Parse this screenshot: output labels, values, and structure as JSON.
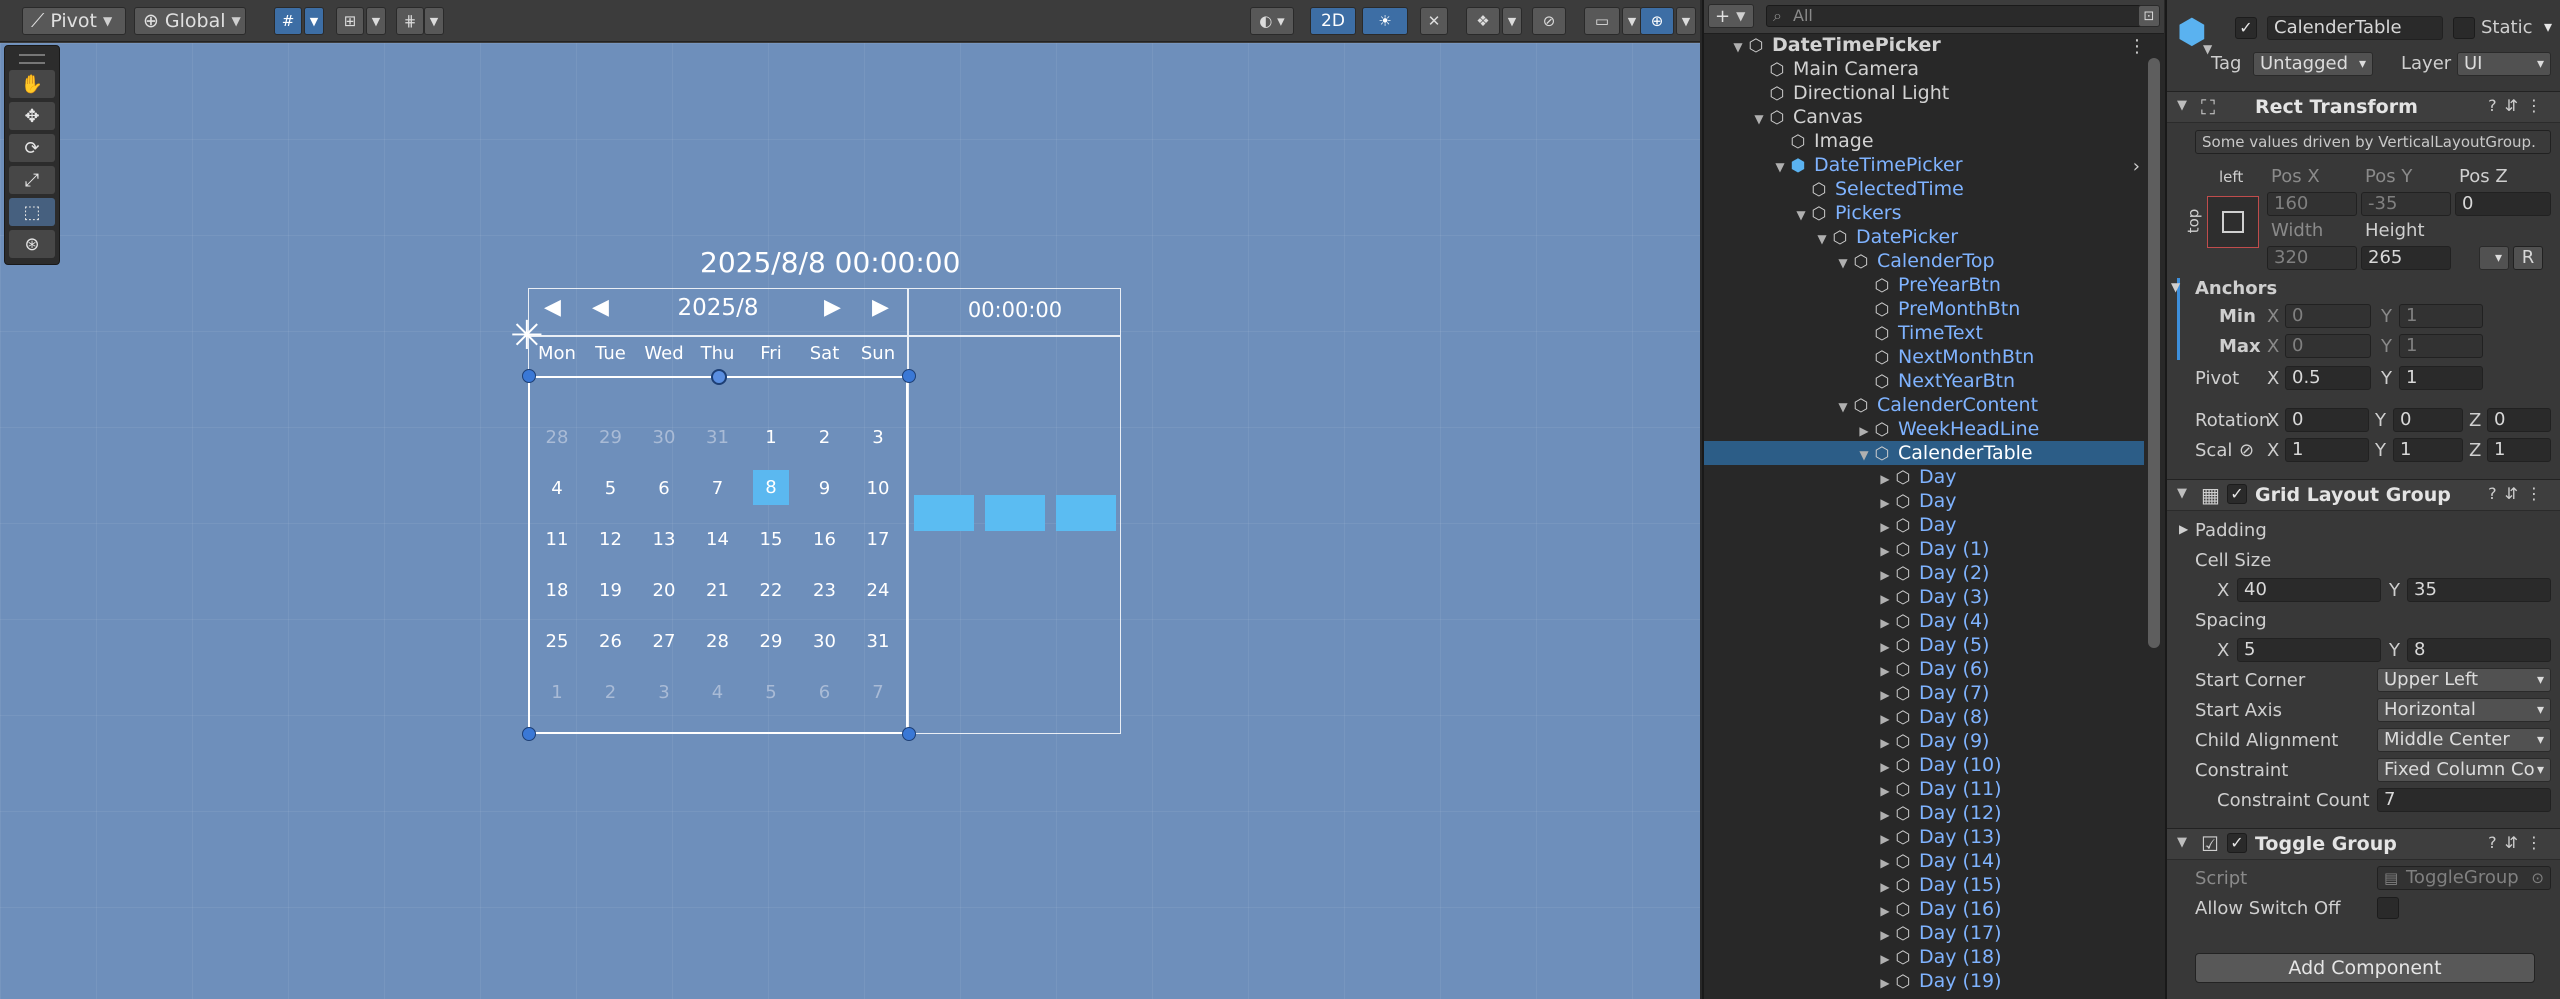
{
  "scene_toolbar": {
    "pivot_label": "Pivot",
    "global_label": "Global",
    "mode_2d_label": "2D"
  },
  "calendar": {
    "date_time_text": "2025/8/8 00:00:00",
    "month_text": "2025/8",
    "prev_year_glyph": "◀",
    "prev_month_glyph": "◀",
    "next_month_glyph": "▶",
    "next_year_glyph": "▶",
    "time_text": "00:00:00",
    "weekdays": [
      "Mon",
      "Tue",
      "Wed",
      "Thu",
      "Fri",
      "Sat",
      "Sun"
    ],
    "rows": [
      [
        "28",
        "29",
        "30",
        "31",
        "1",
        "2",
        "3"
      ],
      [
        "4",
        "5",
        "6",
        "7",
        "8",
        "9",
        "10"
      ],
      [
        "11",
        "12",
        "13",
        "14",
        "15",
        "16",
        "17"
      ],
      [
        "18",
        "19",
        "20",
        "21",
        "22",
        "23",
        "24"
      ],
      [
        "25",
        "26",
        "27",
        "28",
        "29",
        "30",
        "31"
      ],
      [
        "1",
        "2",
        "3",
        "4",
        "5",
        "6",
        "7"
      ]
    ],
    "selected_day": "8",
    "accent_color": "#5bb8f0"
  },
  "hierarchy": {
    "search_placeholder": "All",
    "items": [
      {
        "label": "DateTimePicker",
        "depth": 0,
        "bold": true,
        "expanded": true
      },
      {
        "label": "Main Camera",
        "depth": 1
      },
      {
        "label": "Directional Light",
        "depth": 1
      },
      {
        "label": "Canvas",
        "depth": 1,
        "expanded": true
      },
      {
        "label": "Image",
        "depth": 2
      },
      {
        "label": "DateTimePicker",
        "depth": 2,
        "blue": true,
        "expanded": true,
        "prefab": true
      },
      {
        "label": "SelectedTime",
        "depth": 3,
        "blue": true
      },
      {
        "label": "Pickers",
        "depth": 3,
        "blue": true,
        "expanded": true
      },
      {
        "label": "DatePicker",
        "depth": 4,
        "blue": true,
        "expanded": true
      },
      {
        "label": "CalenderTop",
        "depth": 5,
        "blue": true,
        "expanded": true
      },
      {
        "label": "PreYearBtn",
        "depth": 6,
        "blue": true
      },
      {
        "label": "PreMonthBtn",
        "depth": 6,
        "blue": true
      },
      {
        "label": "TimeText",
        "depth": 6,
        "blue": true
      },
      {
        "label": "NextMonthBtn",
        "depth": 6,
        "blue": true
      },
      {
        "label": "NextYearBtn",
        "depth": 6,
        "blue": true
      },
      {
        "label": "CalenderContent",
        "depth": 5,
        "blue": true,
        "expanded": true
      },
      {
        "label": "WeekHeadLine",
        "depth": 6,
        "blue": true,
        "collapsed": true
      },
      {
        "label": "CalenderTable",
        "depth": 6,
        "selected": true,
        "expanded": true
      },
      {
        "label": "Day",
        "depth": 7,
        "blue": true,
        "collapsed": true
      },
      {
        "label": "Day",
        "depth": 7,
        "blue": true,
        "collapsed": true
      },
      {
        "label": "Day",
        "depth": 7,
        "blue": true,
        "collapsed": true
      },
      {
        "label": "Day (1)",
        "depth": 7,
        "blue": true,
        "collapsed": true
      },
      {
        "label": "Day (2)",
        "depth": 7,
        "blue": true,
        "collapsed": true
      },
      {
        "label": "Day (3)",
        "depth": 7,
        "blue": true,
        "collapsed": true
      },
      {
        "label": "Day (4)",
        "depth": 7,
        "blue": true,
        "collapsed": true
      },
      {
        "label": "Day (5)",
        "depth": 7,
        "blue": true,
        "collapsed": true
      },
      {
        "label": "Day (6)",
        "depth": 7,
        "blue": true,
        "collapsed": true
      },
      {
        "label": "Day (7)",
        "depth": 7,
        "blue": true,
        "collapsed": true
      },
      {
        "label": "Day (8)",
        "depth": 7,
        "blue": true,
        "collapsed": true
      },
      {
        "label": "Day (9)",
        "depth": 7,
        "blue": true,
        "collapsed": true
      },
      {
        "label": "Day (10)",
        "depth": 7,
        "blue": true,
        "collapsed": true
      },
      {
        "label": "Day (11)",
        "depth": 7,
        "blue": true,
        "collapsed": true
      },
      {
        "label": "Day (12)",
        "depth": 7,
        "blue": true,
        "collapsed": true
      },
      {
        "label": "Day (13)",
        "depth": 7,
        "blue": true,
        "collapsed": true
      },
      {
        "label": "Day (14)",
        "depth": 7,
        "blue": true,
        "collapsed": true
      },
      {
        "label": "Day (15)",
        "depth": 7,
        "blue": true,
        "collapsed": true
      },
      {
        "label": "Day (16)",
        "depth": 7,
        "blue": true,
        "collapsed": true
      },
      {
        "label": "Day (17)",
        "depth": 7,
        "blue": true,
        "collapsed": true
      },
      {
        "label": "Day (18)",
        "depth": 7,
        "blue": true,
        "collapsed": true
      },
      {
        "label": "Day (19)",
        "depth": 7,
        "blue": true,
        "collapsed": true
      }
    ]
  },
  "inspector": {
    "object_name": "CalenderTable",
    "static_label": "Static",
    "tag_label": "Tag",
    "tag_value": "Untagged",
    "layer_label": "Layer",
    "layer_value": "UI",
    "rect_transform": {
      "title": "Rect Transform",
      "driven_note": "Some values driven by VerticalLayoutGroup.",
      "anchor_h_label": "left",
      "anchor_v_label": "top",
      "pos_x_label": "Pos X",
      "pos_y_label": "Pos Y",
      "pos_z_label": "Pos Z",
      "pos_x": "160",
      "pos_y": "-35",
      "pos_z": "0",
      "width_label": "Width",
      "height_label": "Height",
      "width": "320",
      "height": "265",
      "r_label": "R",
      "anchors_label": "Anchors",
      "min_label": "Min",
      "max_label": "Max",
      "min_x": "0",
      "min_y": "1",
      "max_x": "0",
      "max_y": "1",
      "pivot_label": "Pivot",
      "pivot_x": "0.5",
      "pivot_y": "1",
      "rotation_label": "Rotation",
      "rot_x": "0",
      "rot_y": "0",
      "rot_z": "0",
      "scale_label": "Scal",
      "scale_x": "1",
      "scale_y": "1",
      "scale_z": "1",
      "x_label": "X",
      "y_label": "Y",
      "z_label": "Z"
    },
    "grid_layout": {
      "title": "Grid Layout Group",
      "padding_label": "Padding",
      "cell_size_label": "Cell Size",
      "cell_x": "40",
      "cell_y": "35",
      "spacing_label": "Spacing",
      "spacing_x": "5",
      "spacing_y": "8",
      "start_corner_label": "Start Corner",
      "start_corner": "Upper Left",
      "start_axis_label": "Start Axis",
      "start_axis": "Horizontal",
      "child_alignment_label": "Child Alignment",
      "child_alignment": "Middle Center",
      "constraint_label": "Constraint",
      "constraint": "Fixed Column Co",
      "constraint_count_label": "Constraint Count",
      "constraint_count": "7"
    },
    "toggle_group": {
      "title": "Toggle Group",
      "script_label": "Script",
      "script_value": "ToggleGroup",
      "allow_switch_off_label": "Allow Switch Off"
    },
    "add_component_label": "Add Component"
  }
}
